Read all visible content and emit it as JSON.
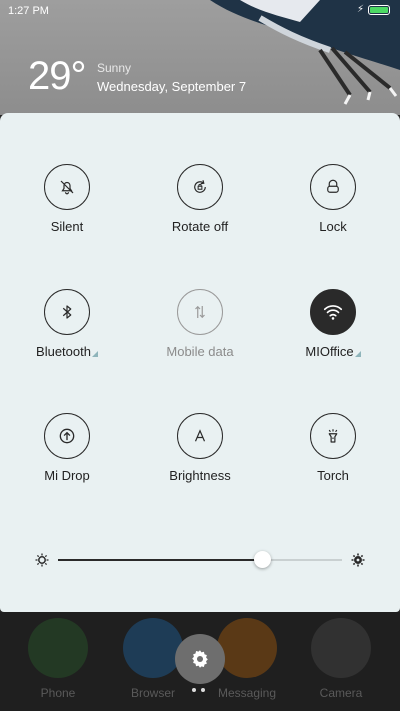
{
  "status_bar": {
    "time": "1:27 PM"
  },
  "weather": {
    "temperature": "29°",
    "condition": "Sunny",
    "date": "Wednesday, September 7"
  },
  "quick_settings": {
    "tiles": [
      {
        "label": "Silent",
        "icon": "bell-off-icon",
        "state": "off"
      },
      {
        "label": "Rotate off",
        "icon": "rotate-lock-icon",
        "state": "off"
      },
      {
        "label": "Lock",
        "icon": "lock-icon",
        "state": "off"
      },
      {
        "label": "Bluetooth",
        "icon": "bluetooth-icon",
        "state": "off",
        "has_settings_indicator": true
      },
      {
        "label": "Mobile data",
        "icon": "mobile-data-icon",
        "state": "disabled"
      },
      {
        "label": "MIOffice",
        "icon": "wifi-icon",
        "state": "on",
        "has_settings_indicator": true
      },
      {
        "label": "Mi Drop",
        "icon": "mi-drop-icon",
        "state": "off"
      },
      {
        "label": "Brightness",
        "icon": "brightness-a-icon",
        "state": "off"
      },
      {
        "label": "Torch",
        "icon": "torch-icon",
        "state": "off"
      }
    ]
  },
  "brightness": {
    "level": 0.72
  },
  "dock": {
    "apps": [
      {
        "label": "Phone",
        "color": "#2e7d32"
      },
      {
        "label": "Browser",
        "color": "#1e88e5"
      },
      {
        "label": "Messaging",
        "color": "#f57c00"
      },
      {
        "label": "Camera",
        "color": "#616161"
      }
    ]
  },
  "colors": {
    "panel_bg": "#e9f1f2",
    "active_tile": "#2a2a2a",
    "indicator": "#8fb5bb"
  }
}
